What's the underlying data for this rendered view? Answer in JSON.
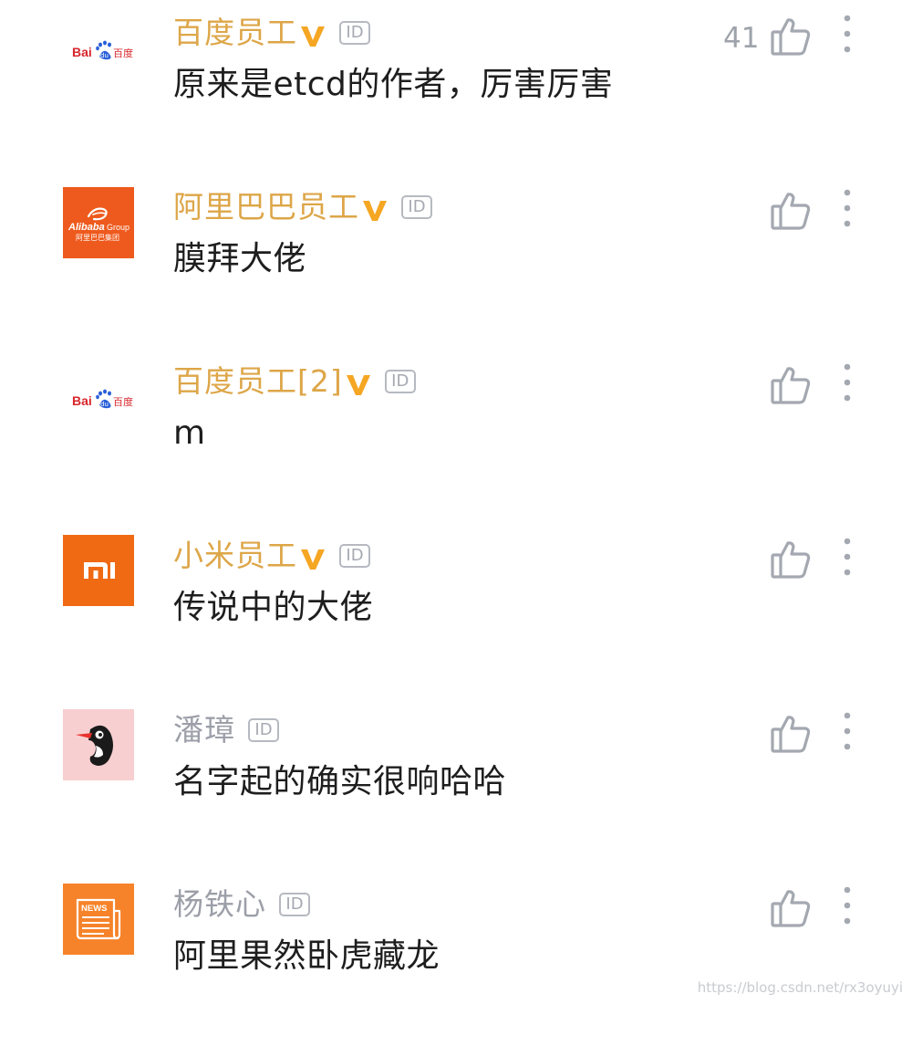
{
  "comments": [
    {
      "username": "百度员工",
      "verified": true,
      "id_badge": "ID",
      "text": "原来是etcd的作者，厉害厉害",
      "like_count": "41",
      "avatar_icon": "baidu-logo-icon",
      "avatar_text": "Bai百度"
    },
    {
      "username": "阿里巴巴员工",
      "verified": true,
      "id_badge": "ID",
      "text": "膜拜大佬",
      "like_count": "",
      "avatar_icon": "alibaba-group-logo-icon",
      "avatar_text": "Alibaba Group 阿里巴巴集团"
    },
    {
      "username": "百度员工[2]",
      "verified": true,
      "id_badge": "ID",
      "text": "m",
      "like_count": "",
      "avatar_icon": "baidu-logo-icon",
      "avatar_text": "Bai百度"
    },
    {
      "username": "小米员工",
      "verified": true,
      "id_badge": "ID",
      "text": "传说中的大佬",
      "like_count": "",
      "avatar_icon": "xiaomi-logo-icon",
      "avatar_text": "mi"
    },
    {
      "username": "潘璋",
      "verified": false,
      "id_badge": "ID",
      "text": "名字起的确实很响哈哈",
      "like_count": "",
      "avatar_icon": "woodpecker-avatar-icon",
      "avatar_text": ""
    },
    {
      "username": "杨铁心",
      "verified": false,
      "id_badge": "ID",
      "text": "阿里果然卧虎藏龙",
      "like_count": "",
      "avatar_icon": "news-avatar-icon",
      "avatar_text": "NEWS"
    }
  ],
  "colors": {
    "verified_name": "#dda648",
    "plain_name": "#9c9fa8",
    "comment_text": "#1e1e1e",
    "icon_gray": "#a4a8b0",
    "v_badge": "#f5a623"
  },
  "watermark": "https://blog.csdn.net/rx3oyuyi"
}
